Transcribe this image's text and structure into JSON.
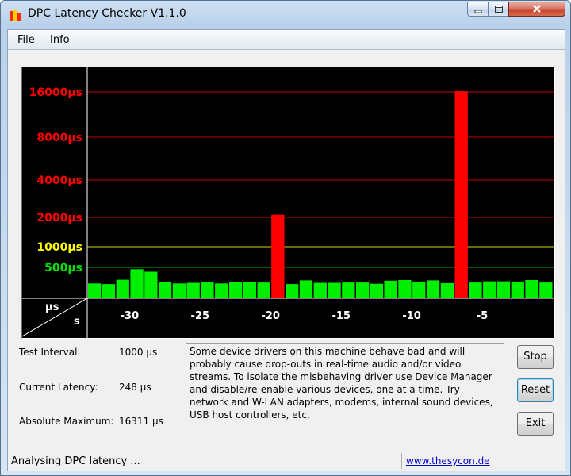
{
  "window": {
    "title": "DPC Latency Checker V1.1.0"
  },
  "menu": {
    "items": [
      "File",
      "Info"
    ]
  },
  "chart_data": {
    "type": "bar",
    "y_scale": "log2",
    "ylabel": "µs",
    "xlabel": "s",
    "y_ticks": [
      {
        "value": 16000,
        "label": "16000µs",
        "color": "#ff0000"
      },
      {
        "value": 8000,
        "label": "8000µs",
        "color": "#ff0000"
      },
      {
        "value": 4000,
        "label": "4000µs",
        "color": "#ff0000"
      },
      {
        "value": 2000,
        "label": "2000µs",
        "color": "#ff0000"
      },
      {
        "value": 1000,
        "label": "1000µs",
        "color": "#ffff00"
      },
      {
        "value": 500,
        "label": "500µs",
        "color": "#00dd00"
      }
    ],
    "x_ticks": [
      -30,
      -25,
      -20,
      -15,
      -10,
      -5
    ],
    "x_tick_labels": [
      "-30",
      "-25",
      "-20",
      "-15",
      "-10",
      "-5"
    ],
    "x": [
      -32,
      -31,
      -30,
      -29,
      -28,
      -27,
      -26,
      -25,
      -24,
      -23,
      -22,
      -21,
      -20,
      -19,
      -18,
      -17,
      -16,
      -15,
      -14,
      -13,
      -12,
      -11,
      -10,
      -9,
      -8,
      -7,
      -6,
      -5,
      -4,
      -3,
      -2,
      -1
    ],
    "values": [
      240,
      230,
      300,
      470,
      430,
      260,
      240,
      250,
      260,
      240,
      260,
      260,
      255,
      2100,
      230,
      290,
      250,
      250,
      255,
      255,
      235,
      285,
      295,
      270,
      290,
      245,
      16311,
      255,
      275,
      275,
      270,
      295,
      255
    ],
    "colors": {
      "normal": "#00ee00",
      "warning": "#ffff00",
      "critical": "#ff0000"
    }
  },
  "info": {
    "test_interval_label": "Test Interval:",
    "test_interval_value": "1000 µs",
    "current_latency_label": "Current Latency:",
    "current_latency_value": "248 µs",
    "absolute_maximum_label": "Absolute Maximum:",
    "absolute_maximum_value": "16311 µs"
  },
  "message": "Some device drivers on this machine behave bad and will probably cause drop-outs in real-time audio and/or video streams. To isolate the misbehaving driver use Device Manager and disable/re-enable various devices, one at a time. Try network and W-LAN adapters, modems, internal sound devices, USB host controllers, etc.",
  "buttons": {
    "stop": "Stop",
    "reset": "Reset",
    "exit": "Exit"
  },
  "status": {
    "text": "Analysing DPC latency ...",
    "link": "www.thesycon.de"
  }
}
